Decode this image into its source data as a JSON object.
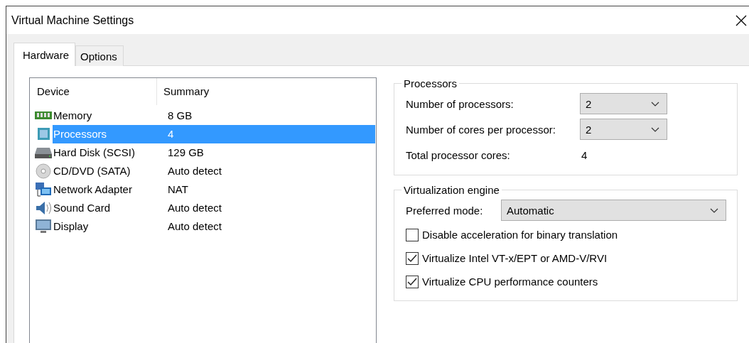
{
  "window": {
    "title": "Virtual Machine Settings"
  },
  "tabs": [
    {
      "label": "Hardware",
      "selected": true
    },
    {
      "label": "Options",
      "selected": false
    }
  ],
  "devices": {
    "columns": [
      "Device",
      "Summary"
    ],
    "rows": [
      {
        "kind": "memory",
        "name": "Memory",
        "summary": "8 GB",
        "selected": false
      },
      {
        "kind": "processor",
        "name": "Processors",
        "summary": "4",
        "selected": true
      },
      {
        "kind": "disk",
        "name": "Hard Disk (SCSI)",
        "summary": "129 GB",
        "selected": false
      },
      {
        "kind": "cd",
        "name": "CD/DVD (SATA)",
        "summary": "Auto detect",
        "selected": false
      },
      {
        "kind": "network",
        "name": "Network Adapter",
        "summary": "NAT",
        "selected": false
      },
      {
        "kind": "sound",
        "name": "Sound Card",
        "summary": "Auto detect",
        "selected": false
      },
      {
        "kind": "display",
        "name": "Display",
        "summary": "Auto detect",
        "selected": false
      }
    ]
  },
  "processors": {
    "title": "Processors",
    "fields": [
      {
        "kind": "select",
        "label": "Number of processors:",
        "value": "2"
      },
      {
        "kind": "select",
        "label": "Number of cores per processor:",
        "value": "2"
      },
      {
        "kind": "text",
        "label": "Total processor cores:",
        "value": "4"
      }
    ]
  },
  "virtualization": {
    "title": "Virtualization engine",
    "mode": {
      "label": "Preferred mode:",
      "value": "Automatic"
    },
    "options": [
      {
        "label": "Disable acceleration for binary translation",
        "checked": false
      },
      {
        "label": "Virtualize Intel VT-x/EPT or AMD-V/RVI",
        "checked": true
      },
      {
        "label": "Virtualize CPU performance counters",
        "checked": true
      }
    ]
  }
}
